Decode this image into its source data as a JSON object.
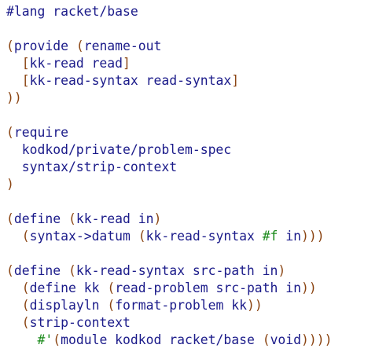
{
  "editor": {
    "lines": [
      [
        [
          "plain",
          "#lang racket/base"
        ]
      ],
      [],
      [
        [
          "paren",
          "("
        ],
        [
          "plain",
          "provide "
        ],
        [
          "paren",
          "("
        ],
        [
          "plain",
          "rename-out"
        ]
      ],
      [
        [
          "plain",
          "  "
        ],
        [
          "paren",
          "["
        ],
        [
          "plain",
          "kk-read read"
        ],
        [
          "paren",
          "]"
        ]
      ],
      [
        [
          "plain",
          "  "
        ],
        [
          "paren",
          "["
        ],
        [
          "plain",
          "kk-read-syntax read-syntax"
        ],
        [
          "paren",
          "]"
        ]
      ],
      [
        [
          "paren",
          "))"
        ]
      ],
      [],
      [
        [
          "paren",
          "("
        ],
        [
          "plain",
          "require"
        ]
      ],
      [
        [
          "plain",
          "  kodkod/private/problem-spec"
        ]
      ],
      [
        [
          "plain",
          "  syntax/strip-context"
        ]
      ],
      [
        [
          "paren",
          ")"
        ]
      ],
      [],
      [
        [
          "paren",
          "("
        ],
        [
          "plain",
          "define "
        ],
        [
          "paren",
          "("
        ],
        [
          "plain",
          "kk-read in"
        ],
        [
          "paren",
          ")"
        ]
      ],
      [
        [
          "plain",
          "  "
        ],
        [
          "paren",
          "("
        ],
        [
          "plain",
          "syntax->datum "
        ],
        [
          "paren",
          "("
        ],
        [
          "plain",
          "kk-read-syntax "
        ],
        [
          "bool",
          "#f"
        ],
        [
          "plain",
          " in"
        ],
        [
          "paren",
          ")))"
        ]
      ],
      [],
      [
        [
          "paren",
          "("
        ],
        [
          "plain",
          "define "
        ],
        [
          "paren",
          "("
        ],
        [
          "plain",
          "kk-read-syntax src-path in"
        ],
        [
          "paren",
          ")"
        ]
      ],
      [
        [
          "plain",
          "  "
        ],
        [
          "paren",
          "("
        ],
        [
          "plain",
          "define kk "
        ],
        [
          "paren",
          "("
        ],
        [
          "plain",
          "read-problem src-path in"
        ],
        [
          "paren",
          "))"
        ]
      ],
      [
        [
          "plain",
          "  "
        ],
        [
          "paren",
          "("
        ],
        [
          "plain",
          "displayln "
        ],
        [
          "paren",
          "("
        ],
        [
          "plain",
          "format-problem kk"
        ],
        [
          "paren",
          "))"
        ]
      ],
      [
        [
          "plain",
          "  "
        ],
        [
          "paren",
          "("
        ],
        [
          "plain",
          "strip-context"
        ]
      ],
      [
        [
          "plain",
          "    "
        ],
        [
          "quote",
          "#'"
        ],
        [
          "paren",
          "("
        ],
        [
          "plain",
          "module kodkod racket/base "
        ],
        [
          "paren",
          "("
        ],
        [
          "plain",
          "void"
        ],
        [
          "paren",
          "))))"
        ]
      ]
    ]
  },
  "colors": {
    "plain": "#1b1b8a",
    "paren": "#8b4513",
    "bool": "#1a8a1a",
    "quote": "#1a8a1a",
    "background": "#ffffff"
  }
}
